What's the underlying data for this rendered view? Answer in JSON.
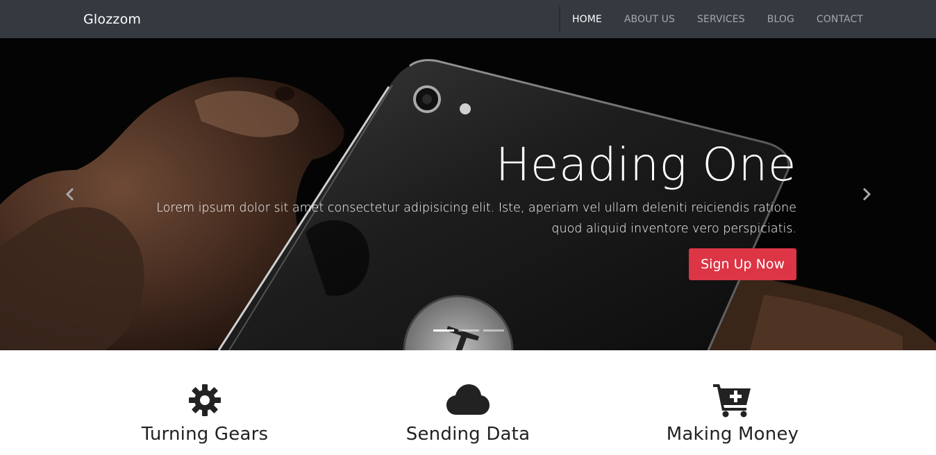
{
  "navbar": {
    "brand": "Glozzom",
    "links": [
      {
        "label": "HOME",
        "active": true
      },
      {
        "label": "ABOUT US",
        "active": false
      },
      {
        "label": "SERVICES",
        "active": false
      },
      {
        "label": "BLOG",
        "active": false
      },
      {
        "label": "CONTACT",
        "active": false
      }
    ]
  },
  "hero": {
    "title": "Heading One",
    "text": "Lorem ipsum dolor sit amet consectetur adipisicing elit. Iste, aperiam vel ullam deleniti reiciendis ratione quod aliquid inventore vero perspiciatis.",
    "cta_label": "Sign Up Now",
    "cta_color": "#dc3545",
    "prev_icon": "chevron-left-icon",
    "next_icon": "chevron-right-icon",
    "slide_count": 3,
    "active_slide": 0
  },
  "features": [
    {
      "title": "Turning Gears",
      "icon": "gear-icon"
    },
    {
      "title": "Sending Data",
      "icon": "cloud-icon"
    },
    {
      "title": "Making Money",
      "icon": "cart-plus-icon"
    }
  ],
  "colors": {
    "navbar_bg": "#343a40",
    "accent": "#dc3545",
    "icon": "#222222"
  }
}
